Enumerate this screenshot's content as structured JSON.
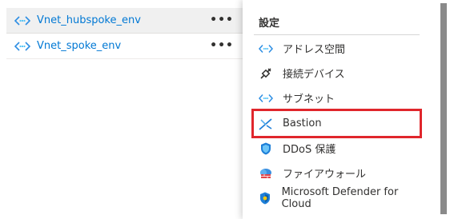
{
  "vnets": [
    {
      "name": "Vnet_hubspoke_env",
      "more": "•••",
      "icon": "vnet-icon"
    },
    {
      "name": "Vnet_spoke_env",
      "more": "•••",
      "icon": "vnet-icon"
    }
  ],
  "menu": {
    "title": "設定",
    "items": [
      {
        "label": "アドレス空間",
        "icon": "address-space-icon"
      },
      {
        "label": "接続デバイス",
        "icon": "connected-devices-icon"
      },
      {
        "label": "サブネット",
        "icon": "subnet-icon"
      },
      {
        "label": "Bastion",
        "icon": "bastion-icon"
      },
      {
        "label": "DDoS 保護",
        "icon": "ddos-shield-icon"
      },
      {
        "label": "ファイアウォール",
        "icon": "firewall-icon"
      },
      {
        "label": "Microsoft Defender for Cloud",
        "icon": "defender-shield-icon"
      }
    ]
  },
  "colors": {
    "link": "#0078d4",
    "highlight": "#e0262c",
    "selected_row": "#f0f0f0"
  }
}
